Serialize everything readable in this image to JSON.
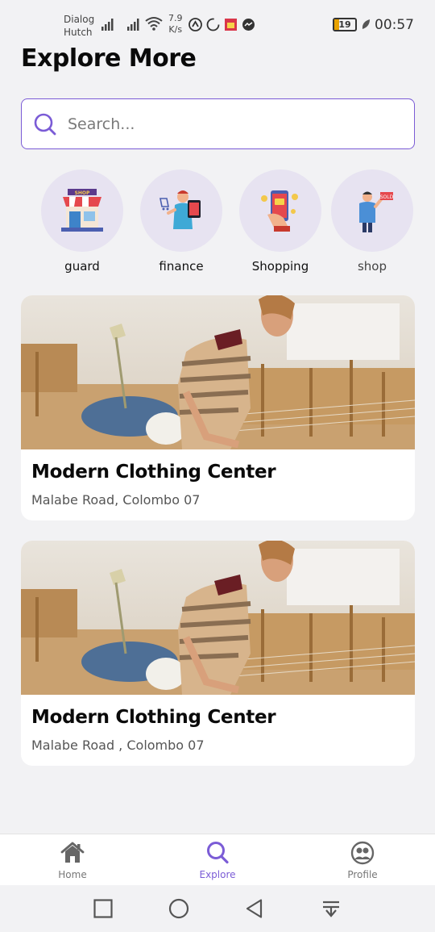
{
  "status_bar": {
    "carrier_1": "Dialog",
    "carrier_2": "Hutch",
    "net_speed_value": "7.9",
    "net_speed_unit": "K/s",
    "battery": "19",
    "time": "00:57"
  },
  "page": {
    "title": "Explore More"
  },
  "search": {
    "placeholder": "Search..."
  },
  "categories": [
    {
      "label": "guard",
      "icon": "shop-storefront-icon"
    },
    {
      "label": "finance",
      "icon": "tablet-shopping-icon"
    },
    {
      "label": "Shopping",
      "icon": "phone-payment-icon"
    },
    {
      "label": "shop",
      "icon": "seller-sold-icon"
    }
  ],
  "shops": [
    {
      "name": "Modern Clothing Center",
      "address": "Malabe Road, Colombo 07",
      "image": "weaving-workshop-photo"
    },
    {
      "name": "Modern Clothing Center",
      "address": "Malabe Road , Colombo 07",
      "image": "weaving-workshop-photo"
    }
  ],
  "bottom_nav": {
    "items": [
      {
        "label": "Home",
        "icon": "home-icon"
      },
      {
        "label": "Explore",
        "icon": "search-icon",
        "active": true
      },
      {
        "label": "Profile",
        "icon": "profile-icon"
      }
    ]
  },
  "colors": {
    "accent": "#7b5cd6",
    "background": "#f2f2f4",
    "category_bg": "#e7e3f1"
  }
}
